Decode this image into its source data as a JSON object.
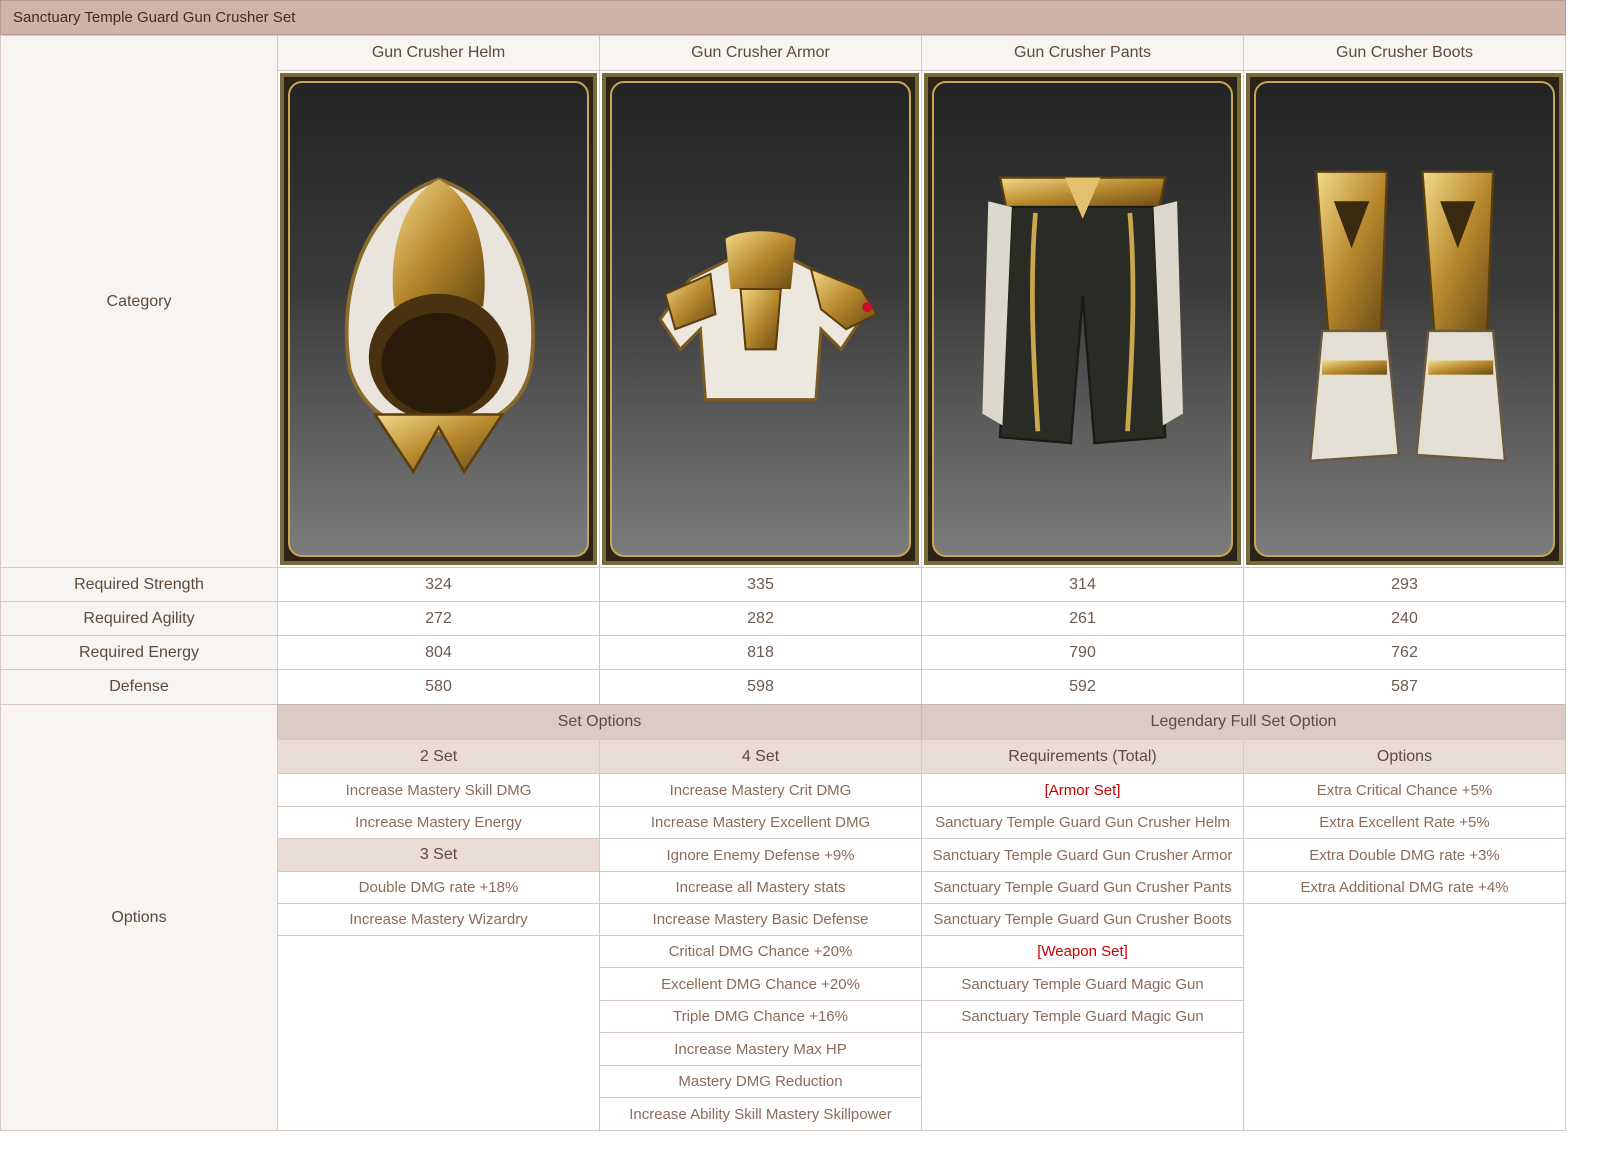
{
  "title": "Sanctuary Temple Guard Gun Crusher Set",
  "labels": {
    "category": "Category",
    "strength": "Required Strength",
    "agility": "Required Agility",
    "energy": "Required Energy",
    "defense": "Defense",
    "options": "Options"
  },
  "items": [
    {
      "name": "Gun Crusher Helm",
      "icon": "helm-icon",
      "strength": "324",
      "agility": "272",
      "energy": "804",
      "defense": "580"
    },
    {
      "name": "Gun Crusher Armor",
      "icon": "armor-icon",
      "strength": "335",
      "agility": "282",
      "energy": "818",
      "defense": "598"
    },
    {
      "name": "Gun Crusher Pants",
      "icon": "pants-icon",
      "strength": "314",
      "agility": "261",
      "energy": "790",
      "defense": "592"
    },
    {
      "name": "Gun Crusher Boots",
      "icon": "boots-icon",
      "strength": "293",
      "agility": "240",
      "energy": "762",
      "defense": "587"
    }
  ],
  "set_options": {
    "header": "Set Options",
    "two_set": {
      "header": "2 Set",
      "items": [
        "Increase Mastery Skill DMG",
        "Increase Mastery Energy"
      ]
    },
    "three_set": {
      "header": "3 Set",
      "items": [
        "Double DMG rate +18%",
        "Increase Mastery Wizardry"
      ]
    },
    "four_set": {
      "header": "4 Set",
      "items": [
        "Increase Mastery Crit DMG",
        "Increase Mastery Excellent DMG",
        "Ignore Enemy Defense +9%",
        "Increase all Mastery stats",
        "Increase Mastery Basic Defense",
        "Critical DMG Chance +20%",
        "Excellent DMG Chance +20%",
        "Triple DMG Chance +16%",
        "Increase Mastery Max HP",
        "Mastery DMG Reduction",
        "Increase Ability Skill Mastery Skillpower"
      ]
    }
  },
  "legendary": {
    "header": "Legendary Full Set Option",
    "requirements_header": "Requirements (Total)",
    "options_header": "Options",
    "armor_set_label": "[Armor Set]",
    "armor_items": [
      "Sanctuary Temple Guard Gun Crusher Helm",
      "Sanctuary Temple Guard Gun Crusher Armor",
      "Sanctuary Temple Guard Gun Crusher Pants",
      "Sanctuary Temple Guard Gun Crusher Boots"
    ],
    "weapon_set_label": "[Weapon Set]",
    "weapon_items": [
      "Sanctuary Temple Guard Magic Gun",
      "Sanctuary Temple Guard Magic Gun"
    ],
    "options": [
      "Extra Critical Chance +5%",
      "Extra Excellent Rate +5%",
      "Extra Double DMG rate +3%",
      "Extra Additional DMG rate +4%"
    ]
  },
  "colors": {
    "title_bg": "#cfb3a8",
    "label_bg": "#f7f4f1",
    "subheader_bg": "#dccbc4",
    "highlight_red": "#c40000",
    "gold": "#c9a74d"
  }
}
